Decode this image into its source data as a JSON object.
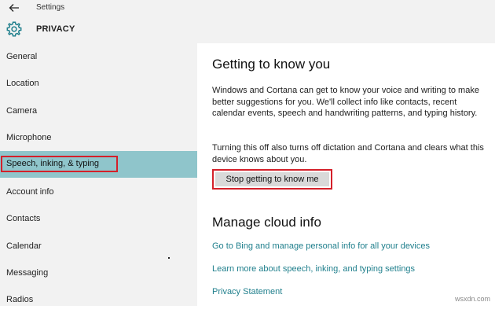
{
  "window": {
    "title": "Settings"
  },
  "header": {
    "title": "PRIVACY",
    "icon": "gear-icon"
  },
  "sidebar": {
    "items": [
      {
        "label": "General"
      },
      {
        "label": "Location"
      },
      {
        "label": "Camera"
      },
      {
        "label": "Microphone"
      },
      {
        "label": "Speech, inking, & typing",
        "selected": true
      },
      {
        "label": "Account info"
      },
      {
        "label": "Contacts"
      },
      {
        "label": "Calendar"
      },
      {
        "label": "Messaging"
      },
      {
        "label": "Radios"
      }
    ]
  },
  "main": {
    "heading": "Getting to know you",
    "paragraph1": "Windows and Cortana can get to know your voice and writing to make better suggestions for you. We'll collect info like contacts, recent calendar events, speech and handwriting patterns, and typing history.",
    "paragraph2": "Turning this off also turns off dictation and Cortana and clears what this device knows about you.",
    "button_label": "Stop getting to know me",
    "heading2": "Manage cloud info",
    "links": [
      "Go to Bing and manage personal info for all your devices",
      "Learn more about speech, inking, and typing settings",
      "Privacy Statement"
    ]
  },
  "watermark": "wsxdn.com",
  "colors": {
    "selected_bg": "#8fc5cb",
    "highlight_outline": "#d4202a",
    "link": "#1f7f8c",
    "pane_bg": "#f2f2f2"
  }
}
